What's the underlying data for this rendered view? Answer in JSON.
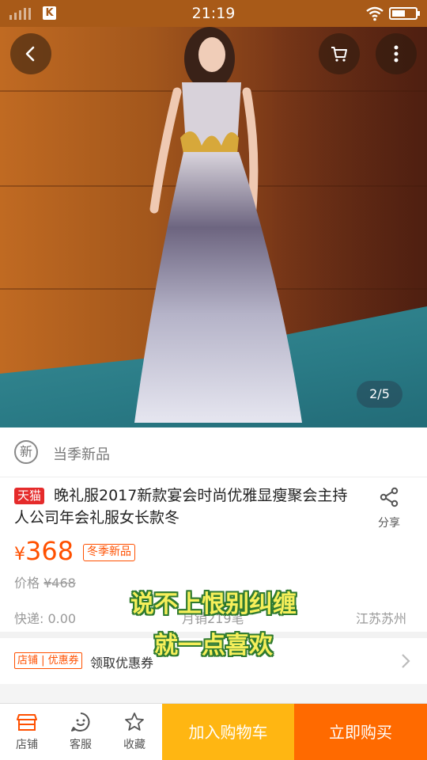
{
  "status_bar": {
    "time": "21:19",
    "app_badge": "K"
  },
  "gallery": {
    "page_indicator": "2/5"
  },
  "new_badge": {
    "icon_char": "新",
    "label": "当季新品"
  },
  "product": {
    "store_badge": "天猫",
    "title": "晚礼服2017新款宴会时尚优雅显瘦聚会主持人公司年会礼服女长款冬",
    "share_label": "分享",
    "currency": "¥",
    "price": "368",
    "price_tag": "冬季新品",
    "old_price_label": "价格",
    "old_price": "¥468",
    "shipping": "快递: 0.00",
    "monthly_sales": "月销219笔",
    "location": "江苏苏州"
  },
  "coupon": {
    "tag": "店铺 | 优惠券",
    "label": "领取优惠券"
  },
  "captions": {
    "line1": "说不上恨别纠缠",
    "line2": "就一点喜欢"
  },
  "bottom_bar": {
    "shop_label": "店铺",
    "service_label": "客服",
    "favorite_label": "收藏",
    "add_to_cart": "加入购物车",
    "buy_now": "立即购买"
  },
  "colors": {
    "accent": "#ff5000",
    "cart_button": "#ffb612",
    "buy_button": "#ff6a00",
    "caption_text": "#f6ef5a"
  }
}
